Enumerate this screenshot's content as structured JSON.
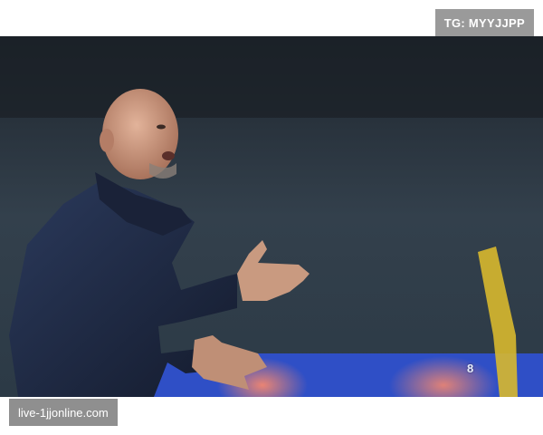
{
  "watermark_top": "TG: MYYJJPP",
  "watermark_bottom": "live-1jjonline.com",
  "photo": {
    "subject": "photo",
    "overlay_logo": "8"
  },
  "colors": {
    "jacket": "#1d2740",
    "skin": "#c99a80",
    "banner_blue": "#2f4fc6",
    "flag_yellow": "#d8b82e"
  }
}
